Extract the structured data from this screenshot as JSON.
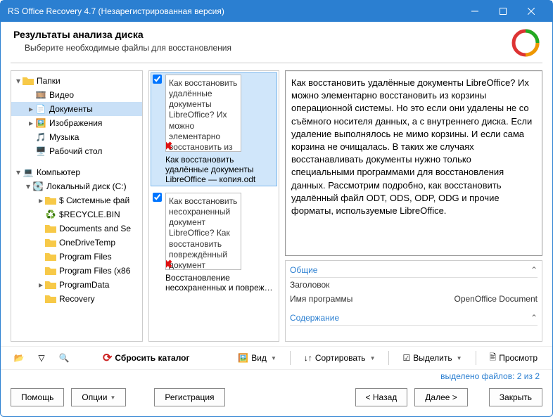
{
  "window": {
    "title": "RS Office Recovery 4.7 (Незарегистрированная версия)"
  },
  "header": {
    "title": "Результаты анализа диска",
    "subtitle": "Выберите необходимые файлы для восстановления"
  },
  "tree": {
    "folders": "Папки",
    "video": "Видео",
    "documents": "Документы",
    "images": "Изображения",
    "music": "Музыка",
    "desktop": "Рабочий стол",
    "computer": "Компьютер",
    "local_disk": "Локальный диск (C:)",
    "sysfiles": "$ Системные фай",
    "recycle": "$RECYCLE.BIN",
    "docset": "Documents and Se",
    "onedrive": "OneDriveTemp",
    "progfiles": "Program Files",
    "progfiles86": "Program Files (x86",
    "progdata": "ProgramData",
    "recovery": "Recovery"
  },
  "files": {
    "item1": {
      "excerpt": "Как восстановить удалённые документы LibreOffice? Их можно элементарно восстановить из корзины операционной",
      "name": "Как восстановить удалённые документы LibreOffice — копия.odt"
    },
    "item2": {
      "excerpt": "Как восстановить несохраненный документ LibreOffice? Как восстановить повреждённый документ LibreOffice?",
      "name": "Восстановление несохраненных и повреж…"
    }
  },
  "preview": {
    "text": "Как восстановить удалённые документы LibreOffice? Их можно элементарно восстановить из корзины операционной системы. Но это если они удалены не со съёмного носителя данных, а с внутреннего диска. Если удаление выполнялось не мимо корзины. И если сама корзина не очищалась. В таких же случаях восстанавливать документы нужно только специальными программами для восстановления данных. Рассмотрим подробно, как восстановить удалённый файл ODT, ODS, ODP, ODG и прочие форматы, используемые LibreOffice."
  },
  "props": {
    "group_general": "Общие",
    "label_title": "Заголовок",
    "label_program": "Имя программы",
    "value_program": "OpenOffice Document",
    "group_content": "Содержание"
  },
  "toolbar": {
    "reset": "Сбросить каталог",
    "view": "Вид",
    "sort": "Сортировать",
    "select": "Выделить",
    "preview": "Просмотр"
  },
  "status": {
    "text": "выделено файлов: 2 из 2"
  },
  "footer": {
    "help": "Помощь",
    "options": "Опции",
    "register": "Регистрация",
    "back": "< Назад",
    "next": "Далее >",
    "close": "Закрыть"
  }
}
